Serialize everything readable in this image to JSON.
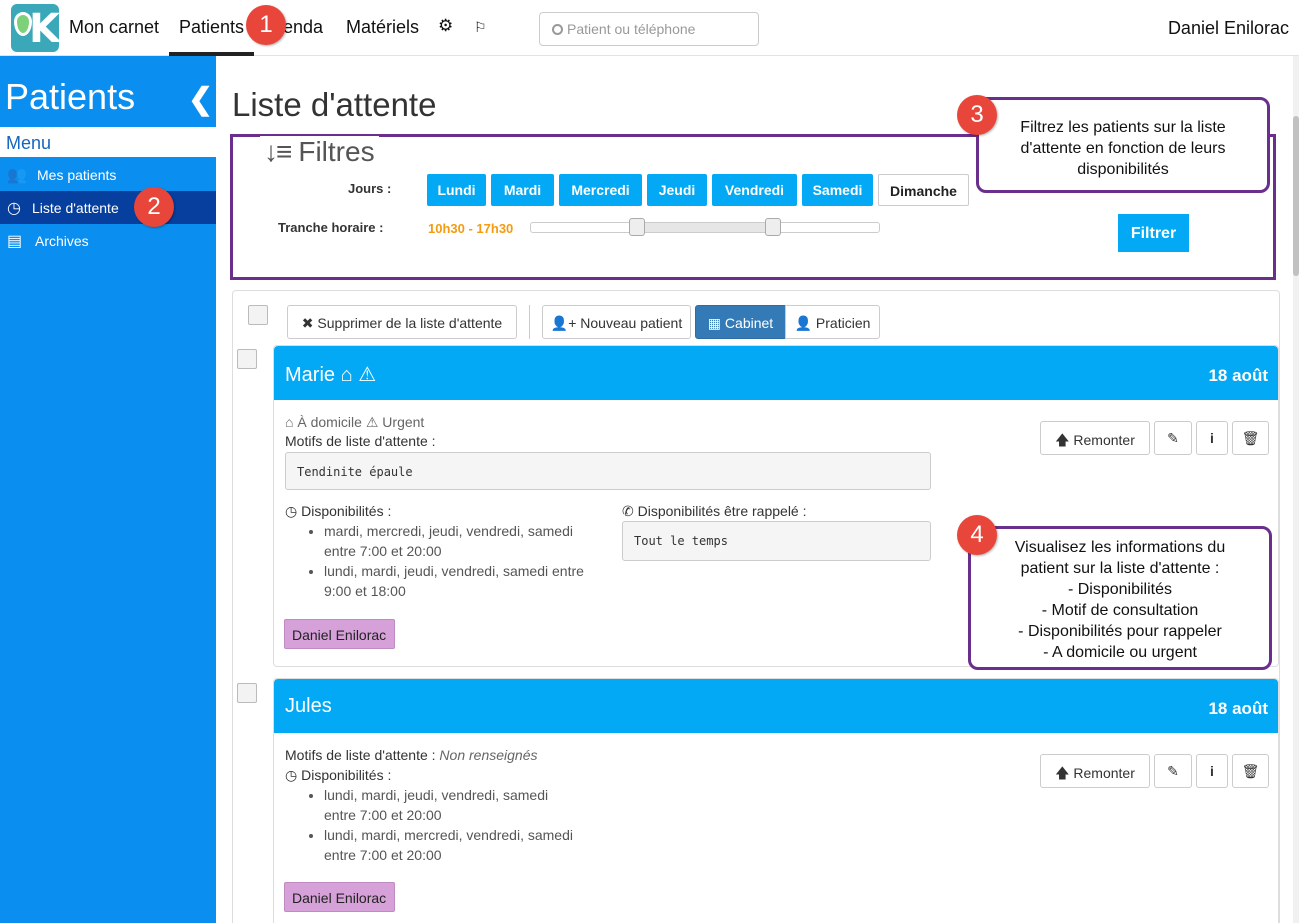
{
  "topnav": {
    "items": [
      "Mon carnet",
      "Patients",
      "Agenda",
      "Matériels"
    ],
    "agenda_visible": "enda",
    "search_placeholder": "Patient ou téléphone",
    "user": "Daniel Enilorac"
  },
  "sidebar": {
    "title": "Patients",
    "menu_label": "Menu",
    "items": [
      {
        "label": "Mes patients",
        "icon": "users-icon"
      },
      {
        "label": "Liste d'attente",
        "icon": "clock-icon"
      },
      {
        "label": "Archives",
        "icon": "archive-icon"
      }
    ]
  },
  "main": {
    "title": "Liste d'attente",
    "filters": {
      "legend": "Filtres",
      "days_label": "Jours :",
      "days": [
        "Lundi",
        "Mardi",
        "Mercredi",
        "Jeudi",
        "Vendredi",
        "Samedi",
        "Dimanche"
      ],
      "days_selected": [
        true,
        true,
        true,
        true,
        true,
        true,
        false
      ],
      "time_label": "Tranche horaire :",
      "time_range": "10h30 - 17h30",
      "slider_low": 0.307,
      "slider_high": 0.693,
      "filter_button": "Filtrer"
    },
    "toolbar": {
      "remove": "Supprimer de la liste d'attente",
      "new_patient": "Nouveau patient",
      "cabinet": "Cabinet",
      "praticien": "Praticien"
    },
    "cards": [
      {
        "name": "Marie",
        "date": "18 août",
        "tags": "À domicile",
        "urgent": "Urgent",
        "motifs_label": "Motifs de liste d'attente :",
        "motif": "Tendinite épaule",
        "dispo_label": "Disponibilités :",
        "dispos": [
          [
            "mardi, mercredi, jeudi, vendredi, samedi",
            "entre 7:00 et 20:00"
          ],
          [
            "lundi, mardi, jeudi, vendredi, samedi entre",
            "9:00 et 18:00"
          ]
        ],
        "rappel_label": "Disponibilités être rappelé :",
        "rappel": "Tout le temps",
        "practitioner": "Daniel Enilorac",
        "remonter": "Remonter"
      },
      {
        "name": "Jules",
        "date": "18 août",
        "motifs_label": "Motifs de liste d'attente :",
        "motif_none": "Non renseignés",
        "dispo_label": "Disponibilités :",
        "dispos": [
          [
            "lundi, mardi, jeudi, vendredi, samedi",
            "entre 7:00 et 20:00"
          ],
          [
            "lundi, mardi, mercredi, vendredi, samedi",
            "entre 7:00 et 20:00"
          ]
        ],
        "practitioner": "Daniel Enilorac",
        "remonter": "Remonter"
      }
    ]
  },
  "callouts": {
    "c3": "Filtrez les patients sur la liste d'attente en fonction de leurs disponibilités",
    "c4_lines": [
      "Visualisez les informations du",
      "patient sur la liste d'attente :",
      "- Disponibilités",
      "- Motif de consultation",
      "- Disponibilités pour rappeler",
      "- A domicile ou urgent"
    ]
  },
  "badges": [
    "1",
    "2",
    "3",
    "4"
  ],
  "colors": {
    "sidebar": "#0a8ff0",
    "accent": "#03a9f4",
    "callout_border": "#6a2e8c",
    "badge": "#e8463a",
    "tag": "#d6a0d8"
  }
}
